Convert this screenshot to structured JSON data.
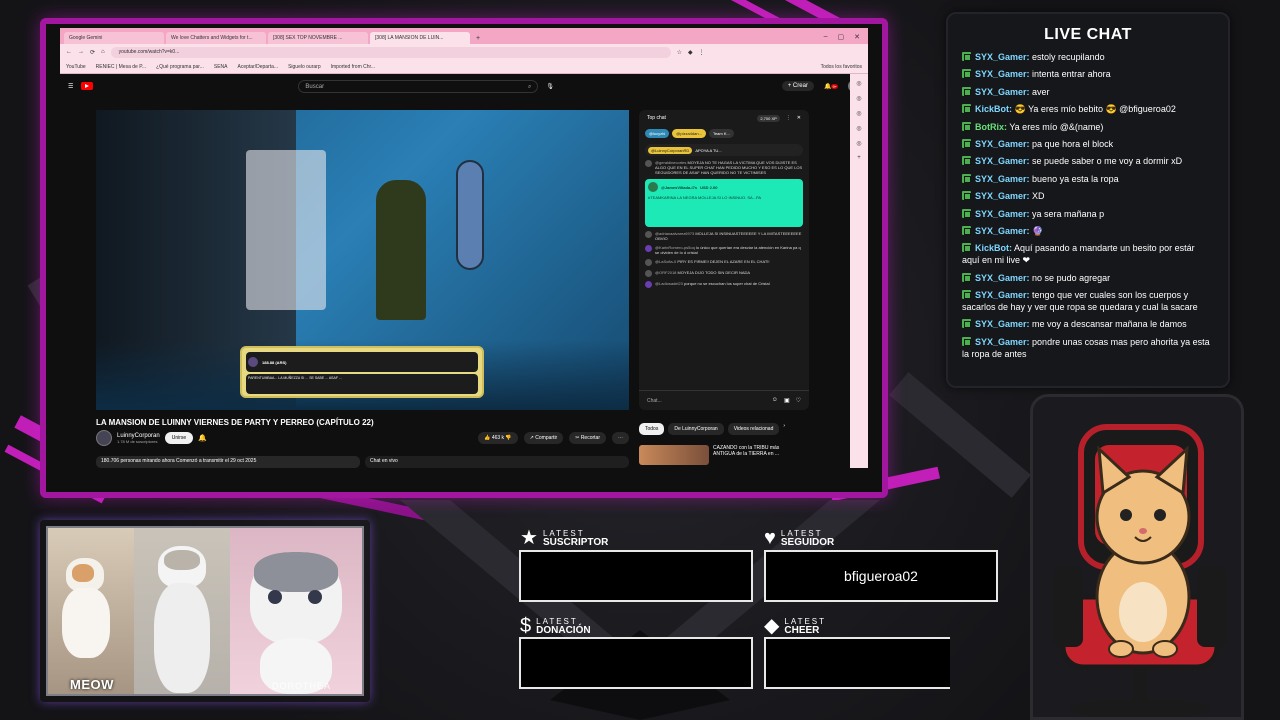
{
  "browser": {
    "tabs": [
      {
        "label": "Google Gemini"
      },
      {
        "label": "We love Chatters and Widgets for t..."
      },
      {
        "label": "[308] SEX TOP NOVEMBRE ..."
      },
      {
        "label": "[308] LA MANSION DE LUIN..."
      }
    ],
    "url": "youtube.com/watch?v=k0...",
    "bookmarks": [
      "YouTube",
      "RENIEC | Mesa de P...",
      "¿Qué programa par...",
      "SENA",
      "Aceptar/Departa...",
      "Siguelo ourarp",
      "Imported from Chr..."
    ],
    "bookmarks_right": "Todos los favoritos"
  },
  "youtube": {
    "search_placeholder": "Buscar",
    "create_label": "+ Crear",
    "notif_count": "9+",
    "superchat_head": "188.88 (ARS)",
    "superchat_msg": "PARENTUMBAA... LA MUÑEZZA SI ... SE SABE ... ASAF ... ",
    "video_title": "LA MANSION DE LUINNY VIERNES DE PARTY Y PERREO (CAPÍTULO 22)",
    "channel_name": "LuinnyCorporan",
    "subscribers": "1.78 M de suscriptores",
    "join_label": "Unirse",
    "likes": "463 k",
    "share_label": "Compartir",
    "clip_label": "Recortar",
    "viewers_text": "180.706 personas mirando ahora  Comenzó a transmitir el 29 oct 2025",
    "chat_label": "Chat en vivo",
    "related_tabs": [
      "Todos",
      "De LuinnyCorporan",
      "Videos relacionad"
    ],
    "related_title": "CAZANDO con la TRIBU más ANTIGUA de la TIERRA en ..."
  },
  "ytchat": {
    "title": "Top chat",
    "xp": "2,700 XP",
    "chips": [
      "@lucyzhi",
      "@pizza4dan...",
      "Team K..."
    ],
    "pinned_user": "@LuinnyCorporanRD",
    "pinned_text": "APOYA A TU...",
    "messages": [
      {
        "user": "@geraldinecortes",
        "text": "MOYEJA NO TE HAGAS LA VICTIMA QUE VOS DIJISTE ES ALGO QUE EN EL SUPER CHAT HAN PEDIDO MUCHO Y ESO ES LO QUE LOS SEGUIDORES DE ASAF HAN QUERIDO NO TE VICTIMISES"
      },
      {
        "user": "@adrianaalvarez6973",
        "text": "MOLLEJA SI INSINUASTEEEEEE Y LA IMITASTEEEEEEE OBVIO"
      },
      {
        "user": "@KarlnRomero-ps5oq",
        "text": "lo único que querían era desviar la atención en Karina pa q se olviden de lo d cristal"
      },
      {
        "user": "@LaSofia-0",
        "text": "PIRY ES FIRME!! DEJEN EL AZARE EN EL CHAT!!"
      },
      {
        "user": "@ORF2018",
        "text": "MOYEJA DIJO TODO SIN DECIR NADA"
      },
      {
        "user": "@Ladiosadel23",
        "text": "porque no se escuchan los super chat de Cristal"
      }
    ],
    "superchat_user": "@JamesVillada-i7s",
    "superchat_amount": "USD 2.00",
    "superchat_text": "#TEAMKARINA LA NEGRA MOLLEJA SI LO INSINUO. SA...PA",
    "input_placeholder": "Chat..."
  },
  "live_chat": {
    "title": "LIVE CHAT",
    "messages": [
      {
        "user": "SYX_Gamer:",
        "text": "estoly recupilando",
        "color": "blue"
      },
      {
        "user": "SYX_Gamer:",
        "text": "intenta entrar ahora",
        "color": "blue"
      },
      {
        "user": "SYX_Gamer:",
        "text": "aver",
        "color": "blue"
      },
      {
        "user": "KickBot:",
        "text": "😎 Ya eres mío bebito 😎 @bfigueroa02",
        "color": "blue"
      },
      {
        "user": "BotRix:",
        "text": "Ya eres mío @&(name)",
        "color": "green"
      },
      {
        "user": "SYX_Gamer:",
        "text": "pa que hora el block",
        "color": "blue"
      },
      {
        "user": "SYX_Gamer:",
        "text": "se puede saber o me voy a dormir xD",
        "color": "blue"
      },
      {
        "user": "SYX_Gamer:",
        "text": "bueno ya esta la ropa",
        "color": "blue"
      },
      {
        "user": "SYX_Gamer:",
        "text": "XD",
        "color": "blue"
      },
      {
        "user": "SYX_Gamer:",
        "text": "ya sera mañana p",
        "color": "blue"
      },
      {
        "user": "SYX_Gamer:",
        "text": "🔮",
        "color": "blue"
      },
      {
        "user": "KickBot:",
        "text": "Aquí pasando a mandarte un besito por estár aquí en mi live ❤",
        "color": "blue"
      },
      {
        "user": "SYX_Gamer:",
        "text": "no se pudo agregar",
        "color": "blue"
      },
      {
        "user": "SYX_Gamer:",
        "text": "tengo que ver cuales son los cuerpos y sacarlos de hay y ver que ropa se quedara y cual la sacare",
        "color": "blue"
      },
      {
        "user": "SYX_Gamer:",
        "text": "me voy a descansar mañana le damos",
        "color": "blue"
      },
      {
        "user": "SYX_Gamer:",
        "text": "pondre unas cosas mas pero ahorita ya esta la ropa de antes",
        "color": "blue"
      }
    ]
  },
  "cam": {
    "label_left": "MEOW",
    "label_right": "DOROTHEA"
  },
  "alerts": {
    "suscriptor": {
      "small": "LATEST",
      "big": "SUSCRIPTOR",
      "value": ""
    },
    "seguidor": {
      "small": "LATEST",
      "big": "SEGUIDOR",
      "value": "bfigueroa02"
    },
    "donacion": {
      "small": "LATEST",
      "big": "DONACIÓN",
      "value": ""
    },
    "cheer": {
      "small": "LATEST",
      "big": "CHEER",
      "value": ""
    }
  },
  "colors": {
    "accent": "#c11fb8",
    "chat_user": "#7fd7ff",
    "badge": "#4caf50"
  }
}
